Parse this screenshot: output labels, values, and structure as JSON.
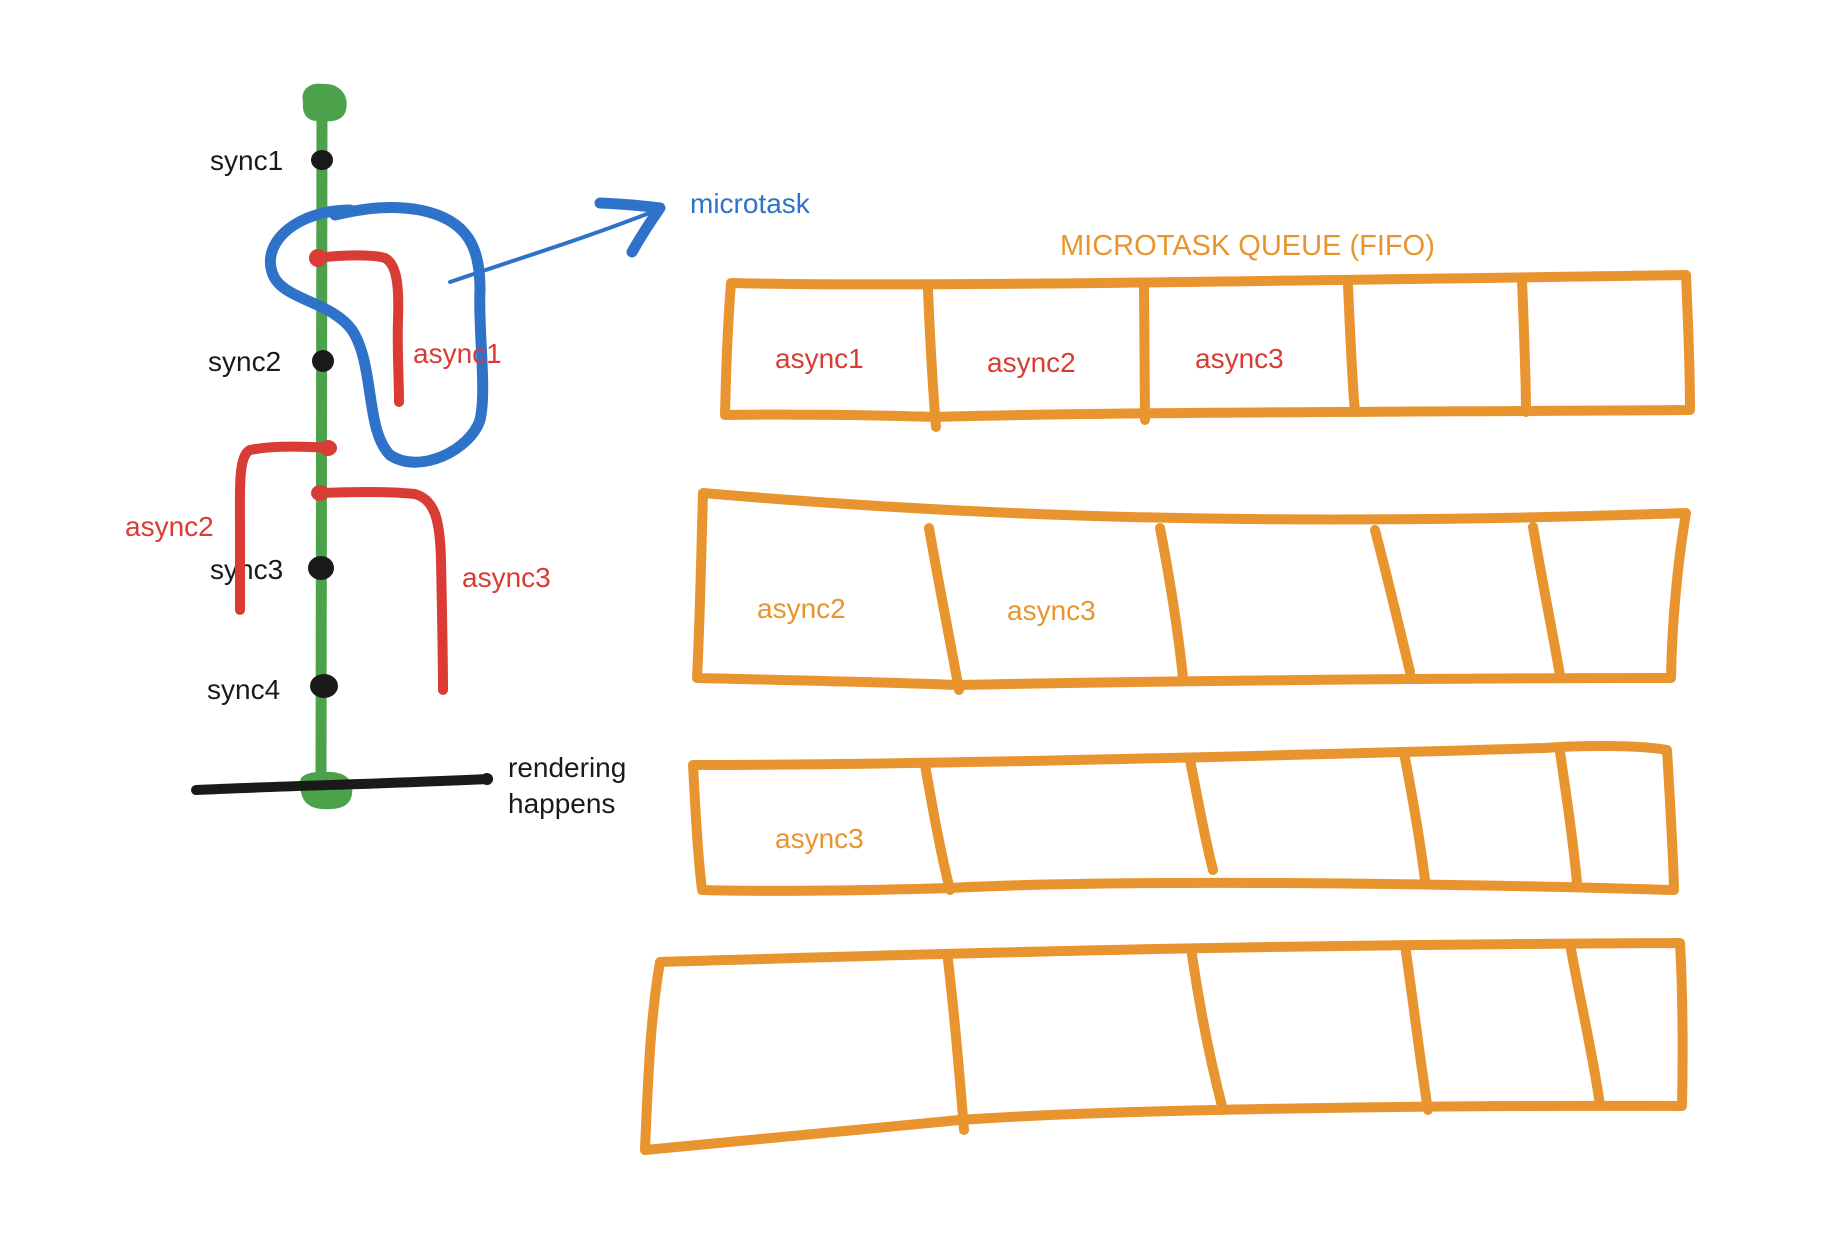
{
  "colors": {
    "timeline": "#4CA24A",
    "sync_dot": "#1A1A1A",
    "async": "#D93B35",
    "microtask": "#2F72C9",
    "queue": "#E8952F",
    "render_line": "#1A1A1A",
    "text": "#1A1A1A"
  },
  "timeline": {
    "sync_labels": [
      "sync1",
      "sync2",
      "sync3",
      "sync4"
    ],
    "async_labels": [
      "async1",
      "async2",
      "async3"
    ],
    "microtask_label": "microtask",
    "render_label": [
      "rendering",
      "happens"
    ]
  },
  "queue": {
    "title": "MICROTASK QUEUE (FIFO)",
    "rows": [
      {
        "cells": [
          "async1",
          "async2",
          "async3",
          "",
          ""
        ],
        "text_color": "#D93B35"
      },
      {
        "cells": [
          "async2",
          "async3",
          "",
          "",
          ""
        ],
        "text_color": "#E8952F"
      },
      {
        "cells": [
          "async3",
          "",
          "",
          "",
          ""
        ],
        "text_color": "#E8952F"
      },
      {
        "cells": [
          "",
          "",
          "",
          "",
          ""
        ],
        "text_color": "#E8952F"
      }
    ]
  }
}
